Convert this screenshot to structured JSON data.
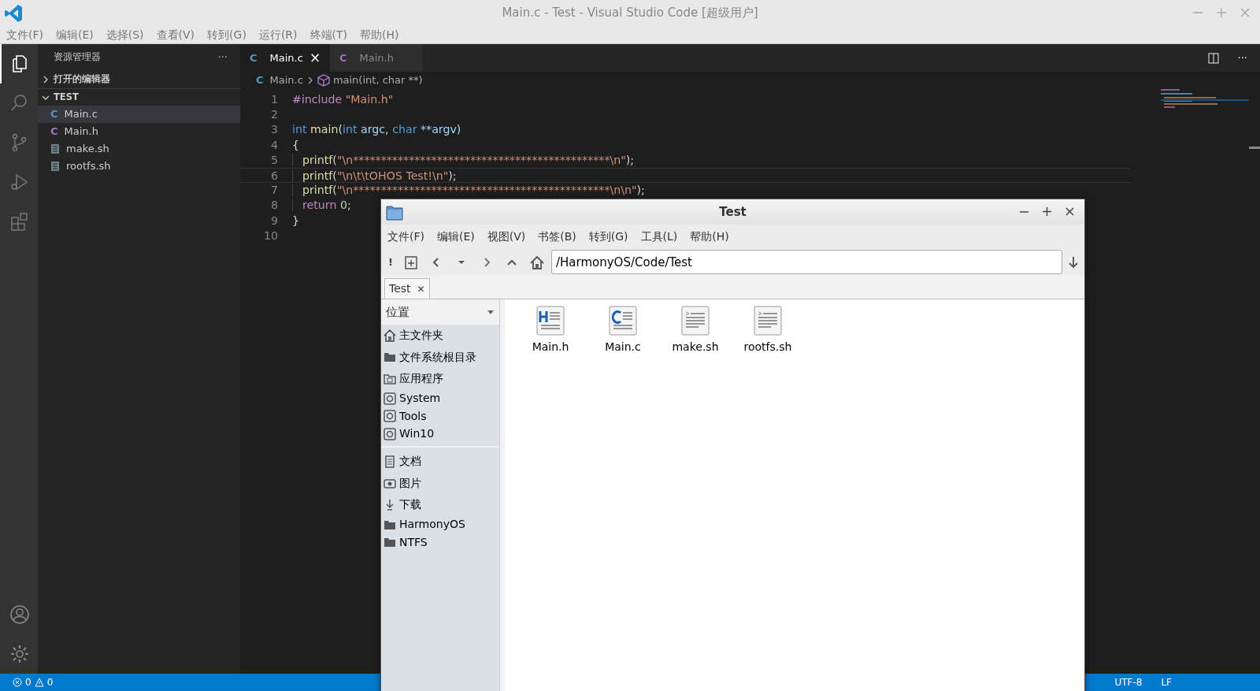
{
  "window": {
    "title": "Main.c - Test - Visual Studio Code [超级用户]"
  },
  "menu": [
    "文件(F)",
    "编辑(E)",
    "选择(S)",
    "查看(V)",
    "转到(G)",
    "运行(R)",
    "终端(T)",
    "帮助(H)"
  ],
  "activity_bar": [
    {
      "kind": "explorer",
      "selected": true
    },
    {
      "kind": "search",
      "selected": false
    },
    {
      "kind": "source-control",
      "selected": false
    },
    {
      "kind": "run",
      "selected": false
    },
    {
      "kind": "extensions",
      "selected": false
    }
  ],
  "activity_bottom": [
    {
      "kind": "account"
    },
    {
      "kind": "settings"
    }
  ],
  "sidebar": {
    "title": "资源管理器",
    "more": "···",
    "sections": [
      {
        "label": "打开的编辑器",
        "expanded": false
      },
      {
        "label": "TEST",
        "expanded": true,
        "files": [
          {
            "name": "Main.c",
            "kind": "c",
            "icon": "C",
            "selected": true
          },
          {
            "name": "Main.h",
            "kind": "h",
            "icon": "C",
            "selected": false
          },
          {
            "name": "make.sh",
            "kind": "sh",
            "selected": false
          },
          {
            "name": "rootfs.sh",
            "kind": "sh",
            "selected": false
          }
        ]
      }
    ]
  },
  "tabs": [
    {
      "label": "Main.c",
      "kind": "c",
      "icon": "C",
      "selected": true,
      "close": "×"
    },
    {
      "label": "Main.h",
      "kind": "h",
      "icon": "C",
      "selected": false
    }
  ],
  "editor_actions": {
    "more": "···"
  },
  "breadcrumb": [
    {
      "label": "Main.c",
      "kind": "file",
      "icon": "C"
    },
    {
      "label": "main(int, char **)",
      "kind": "symbol"
    }
  ],
  "code_lines": [
    {
      "number": "1",
      "indented": false,
      "current": false,
      "tokens": [
        {
          "kind": "keyword",
          "text": "#include"
        },
        {
          "kind": "string",
          "text": "\"Main.h\""
        }
      ]
    },
    {
      "number": "2",
      "indented": false,
      "current": false
    },
    {
      "number": "3",
      "indented": false,
      "current": false,
      "tokens": [
        {
          "kind": "type",
          "text": "int"
        },
        {
          "kind": "func",
          "text": "main"
        },
        {
          "kind": "punct",
          "text": "("
        },
        {
          "kind": "type",
          "text": "int"
        },
        {
          "kind": "param",
          "text": "argc,"
        },
        {
          "kind": "type",
          "text": "char"
        },
        {
          "kind": "param",
          "text": "**argv)"
        }
      ]
    },
    {
      "number": "4",
      "indented": false,
      "current": false,
      "tokens": [
        {
          "kind": "punct",
          "text": "{"
        }
      ]
    },
    {
      "number": "5",
      "indented": true,
      "current": false,
      "tokens": [
        {
          "kind": "func",
          "text": "printf"
        },
        {
          "kind": "punct",
          "text": "("
        },
        {
          "kind": "string",
          "text": "\"\\n**********************************************\\n\""
        },
        {
          "kind": "punct",
          "text": ");"
        }
      ]
    },
    {
      "number": "6",
      "indented": true,
      "current": true,
      "tokens": [
        {
          "kind": "func",
          "text": "printf"
        },
        {
          "kind": "punct",
          "text": "("
        },
        {
          "kind": "string",
          "text": "\"\\n\\t\\tOHOS Test!\\n\""
        },
        {
          "kind": "punct",
          "text": ");"
        }
      ]
    },
    {
      "number": "7",
      "indented": true,
      "current": false,
      "tokens": [
        {
          "kind": "func",
          "text": "printf"
        },
        {
          "kind": "punct",
          "text": "("
        },
        {
          "kind": "string",
          "text": "\"\\n**********************************************\\n\\n\""
        },
        {
          "kind": "punct",
          "text": ");"
        }
      ]
    },
    {
      "number": "8",
      "indented": true,
      "current": false,
      "tokens": [
        {
          "kind": "control",
          "text": "return"
        },
        {
          "kind": "number",
          "text": "0"
        },
        {
          "kind": "punct",
          "text": ";"
        }
      ]
    },
    {
      "number": "9",
      "indented": false,
      "current": false,
      "tokens": [
        {
          "kind": "punct",
          "text": "}"
        }
      ]
    },
    {
      "number": "10",
      "indented": false,
      "current": false
    }
  ],
  "status_bar": {
    "errors": "0",
    "warnings": "0",
    "right": [
      "UTF-8",
      "LF"
    ]
  },
  "file_manager": {
    "title": "Test",
    "menu": [
      "文件(F)",
      "编辑(E)",
      "视图(V)",
      "书签(B)",
      "转到(G)",
      "工具(L)",
      "帮助(H)"
    ],
    "toolbar_text": "!",
    "path": "/HarmonyOS/Code/Test",
    "tabs": [
      {
        "label": "Test",
        "close": "✕",
        "selected": true
      }
    ],
    "places_header": "位置",
    "place_groups": [
      {
        "items": [
          {
            "label": "主文件夹",
            "kind": "home"
          },
          {
            "label": "文件系统根目录",
            "kind": "folder"
          },
          {
            "label": "应用程序",
            "kind": "apps"
          },
          {
            "label": "System",
            "kind": "disk"
          },
          {
            "label": "Tools",
            "kind": "disk"
          },
          {
            "label": "Win10",
            "kind": "disk"
          }
        ]
      },
      {
        "items": [
          {
            "label": "文档",
            "kind": "doc"
          },
          {
            "label": "图片",
            "kind": "camera"
          },
          {
            "label": "下载",
            "kind": "download"
          },
          {
            "label": "HarmonyOS",
            "kind": "folder"
          },
          {
            "label": "NTFS",
            "kind": "folder"
          }
        ]
      }
    ],
    "files": [
      {
        "name": "Main.h",
        "kind": "h"
      },
      {
        "name": "Main.c",
        "kind": "c"
      },
      {
        "name": "make.sh",
        "kind": "script"
      },
      {
        "name": "rootfs.sh",
        "kind": "script"
      }
    ]
  }
}
